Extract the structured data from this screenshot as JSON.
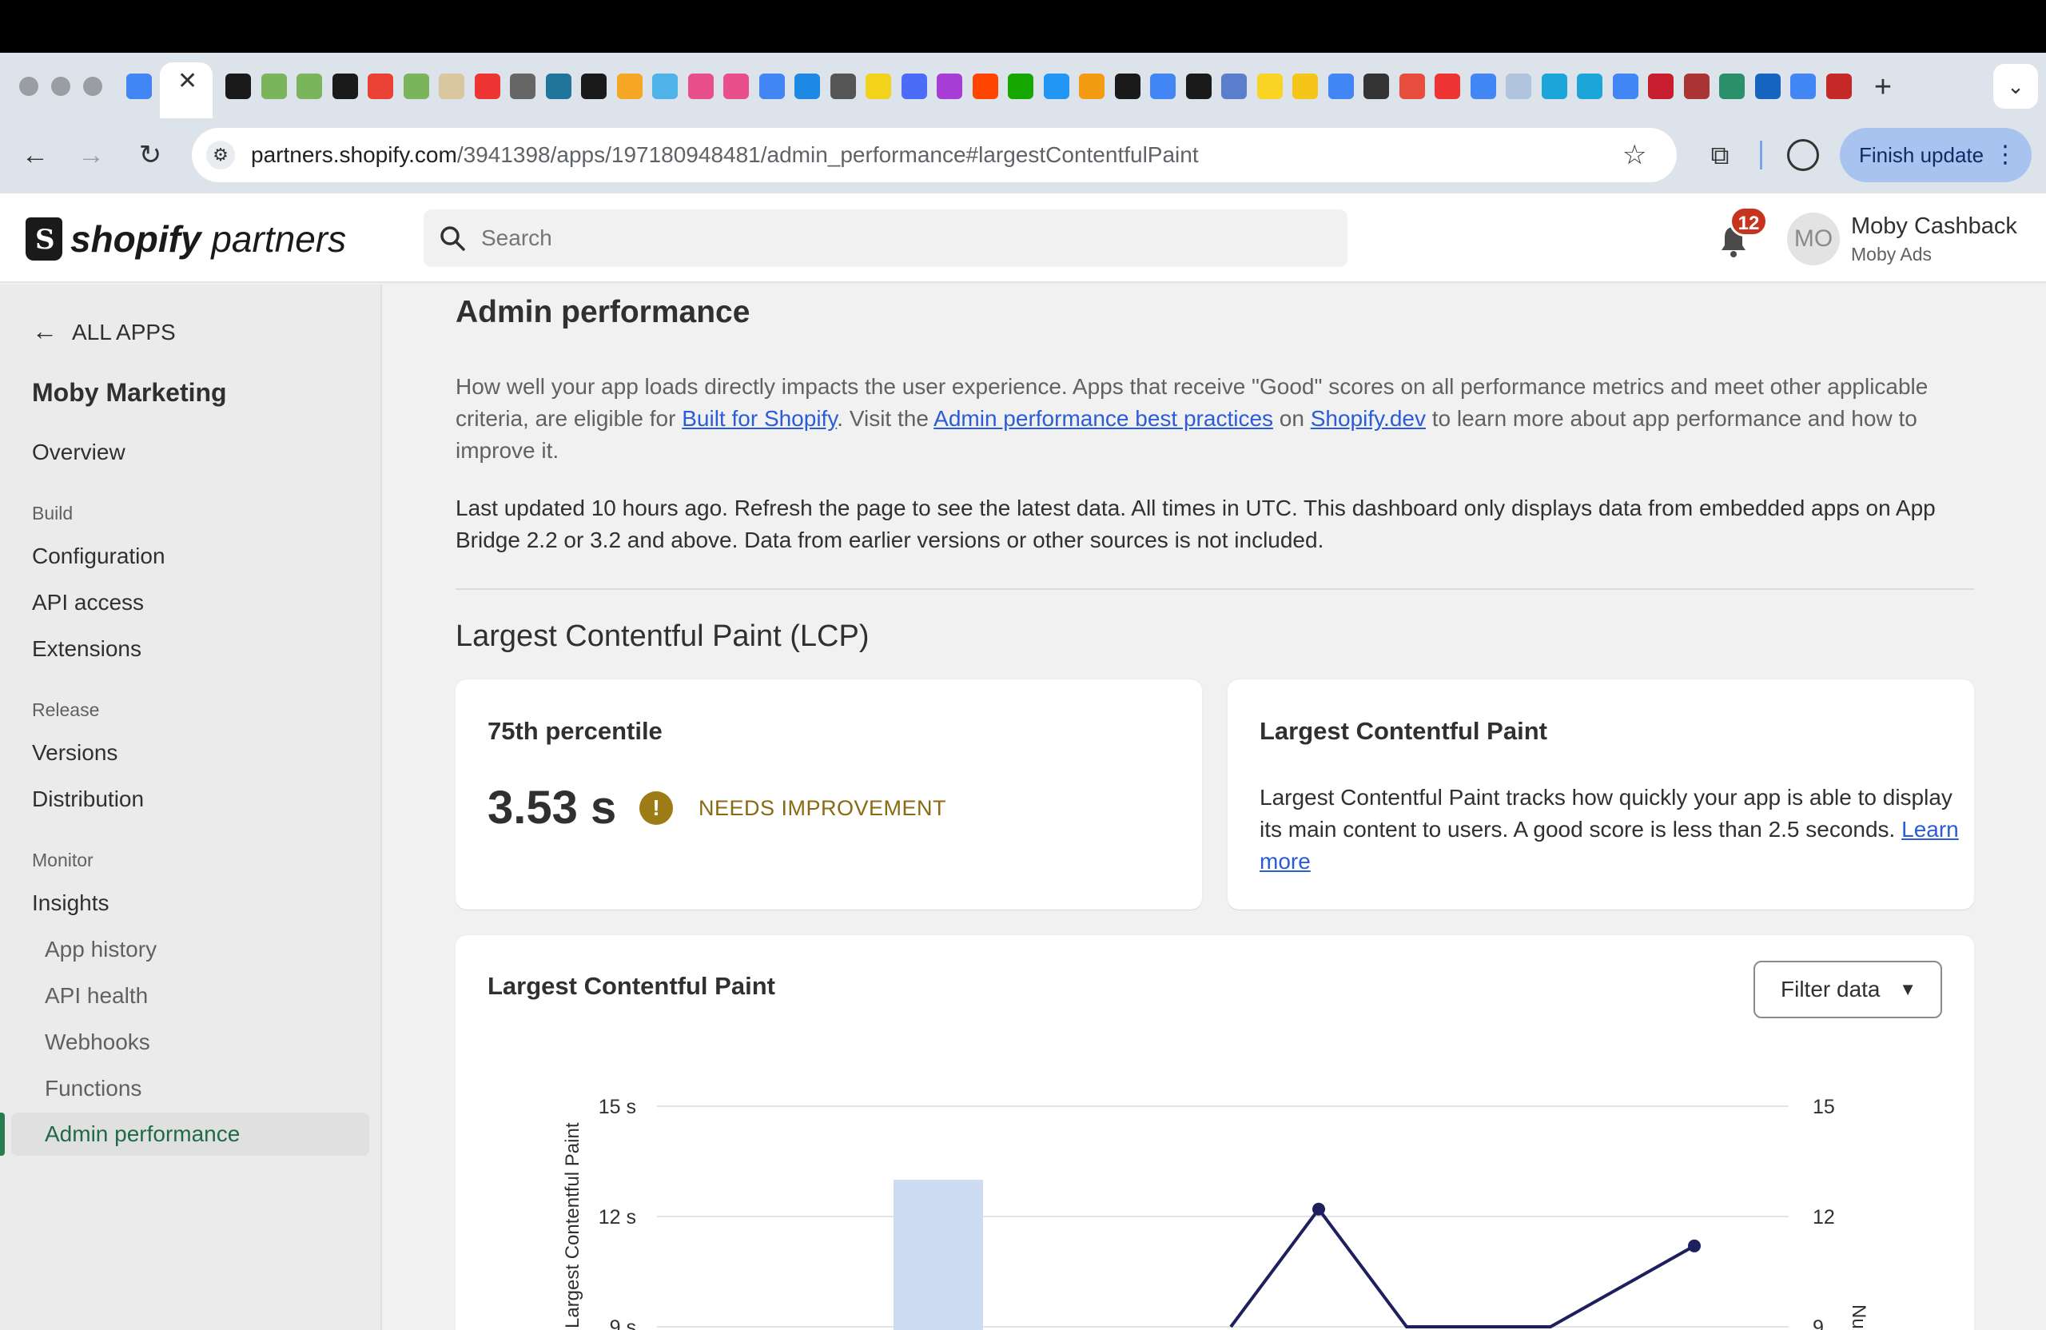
{
  "browser": {
    "url_host": "partners.shopify.com",
    "url_path": "/3941398/apps/197180948481/admin_performance#largestContentfulPaint",
    "finish_update_label": "Finish update",
    "tab_close": "✕"
  },
  "header": {
    "logo_bold": "shopify",
    "logo_light": "partners",
    "search_placeholder": "Search",
    "notification_count": "12",
    "avatar_initials": "MO",
    "user_name": "Moby Cashback",
    "user_org": "Moby Ads"
  },
  "sidebar": {
    "back_label": "ALL APPS",
    "app_name": "Moby Marketing",
    "overview": "Overview",
    "sections": [
      {
        "title": "Build",
        "items": [
          "Configuration",
          "API access",
          "Extensions"
        ]
      },
      {
        "title": "Release",
        "items": [
          "Versions",
          "Distribution"
        ]
      },
      {
        "title": "Monitor",
        "items": [
          "Insights"
        ]
      }
    ],
    "insights_sub": [
      "App history",
      "API health",
      "Webhooks",
      "Functions",
      "Admin performance"
    ],
    "active": "Admin performance"
  },
  "main": {
    "title": "Admin performance",
    "intro_1": "How well your app loads directly impacts the user experience. Apps that receive \"Good\" scores on all performance metrics and meet other applicable criteria, are eligible for ",
    "link_built": "Built for Shopify",
    "intro_2": ". Visit the ",
    "link_best": "Admin performance best practices",
    "intro_3": " on ",
    "link_dev": "Shopify.dev",
    "intro_4": " to learn more about app performance and how to improve it.",
    "updated": "Last updated 10 hours ago. Refresh the page to see the latest data. All times in UTC. This dashboard only displays data from embedded apps on App Bridge 2.2 or 3.2 and above. Data from earlier versions or other sources is not included.",
    "section_title": "Largest Contentful Paint (LCP)",
    "percentile_card": {
      "title": "75th percentile",
      "value": "3.53 s",
      "status": "NEEDS IMPROVEMENT",
      "status_color": "#9e7c15"
    },
    "info_card": {
      "title": "Largest Contentful Paint",
      "desc": "Largest Contentful Paint tracks how quickly your app is able to display its main content to users. A good score is less than 2.5 seconds. ",
      "link": "Learn more"
    },
    "chart_card": {
      "title": "Largest Contentful Paint",
      "filter_label": "Filter data"
    }
  },
  "chart_data": {
    "type": "bar",
    "title": "Largest Contentful Paint",
    "left_axis": {
      "label": "...ul Paint",
      "ticks": [
        "15 s",
        "12 s",
        "9 s"
      ],
      "ylim": [
        9,
        15
      ]
    },
    "right_axis": {
      "label": "Nu...",
      "ticks": [
        "15",
        "12",
        "9"
      ],
      "ylim": [
        9,
        15
      ]
    },
    "bars": [
      {
        "x_index": 0,
        "value": 13
      }
    ],
    "line_points": [
      {
        "x_index": 1,
        "value": 9
      },
      {
        "x_index": 2,
        "value": 12.2
      },
      {
        "x_index": 3,
        "value": 9
      },
      {
        "x_index": 4,
        "value": 9
      },
      {
        "x_index": 5,
        "value": 11.2
      }
    ],
    "bar_color": "#cddbf3",
    "line_color": "#1e1f5e"
  }
}
